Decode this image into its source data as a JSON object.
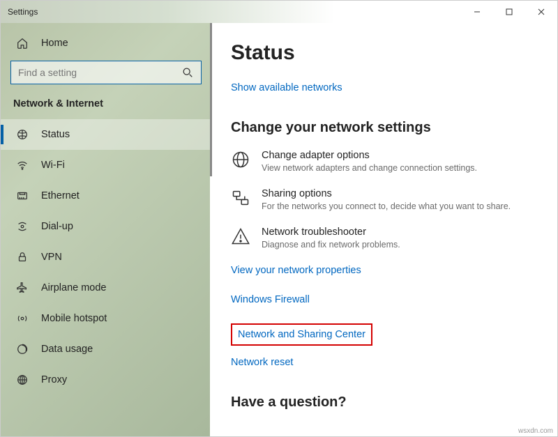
{
  "window": {
    "title": "Settings"
  },
  "sidebar": {
    "home": "Home",
    "search_placeholder": "Find a setting",
    "section": "Network & Internet",
    "items": [
      {
        "label": "Status"
      },
      {
        "label": "Wi-Fi"
      },
      {
        "label": "Ethernet"
      },
      {
        "label": "Dial-up"
      },
      {
        "label": "VPN"
      },
      {
        "label": "Airplane mode"
      },
      {
        "label": "Mobile hotspot"
      },
      {
        "label": "Data usage"
      },
      {
        "label": "Proxy"
      }
    ]
  },
  "main": {
    "title": "Status",
    "show_networks": "Show available networks",
    "change_heading": "Change your network settings",
    "options": [
      {
        "title": "Change adapter options",
        "desc": "View network adapters and change connection settings."
      },
      {
        "title": "Sharing options",
        "desc": "For the networks you connect to, decide what you want to share."
      },
      {
        "title": "Network troubleshooter",
        "desc": "Diagnose and fix network problems."
      }
    ],
    "links": {
      "properties": "View your network properties",
      "firewall": "Windows Firewall",
      "sharing_center": "Network and Sharing Center",
      "reset": "Network reset"
    },
    "question": "Have a question?"
  },
  "watermark": "wsxdn.com"
}
